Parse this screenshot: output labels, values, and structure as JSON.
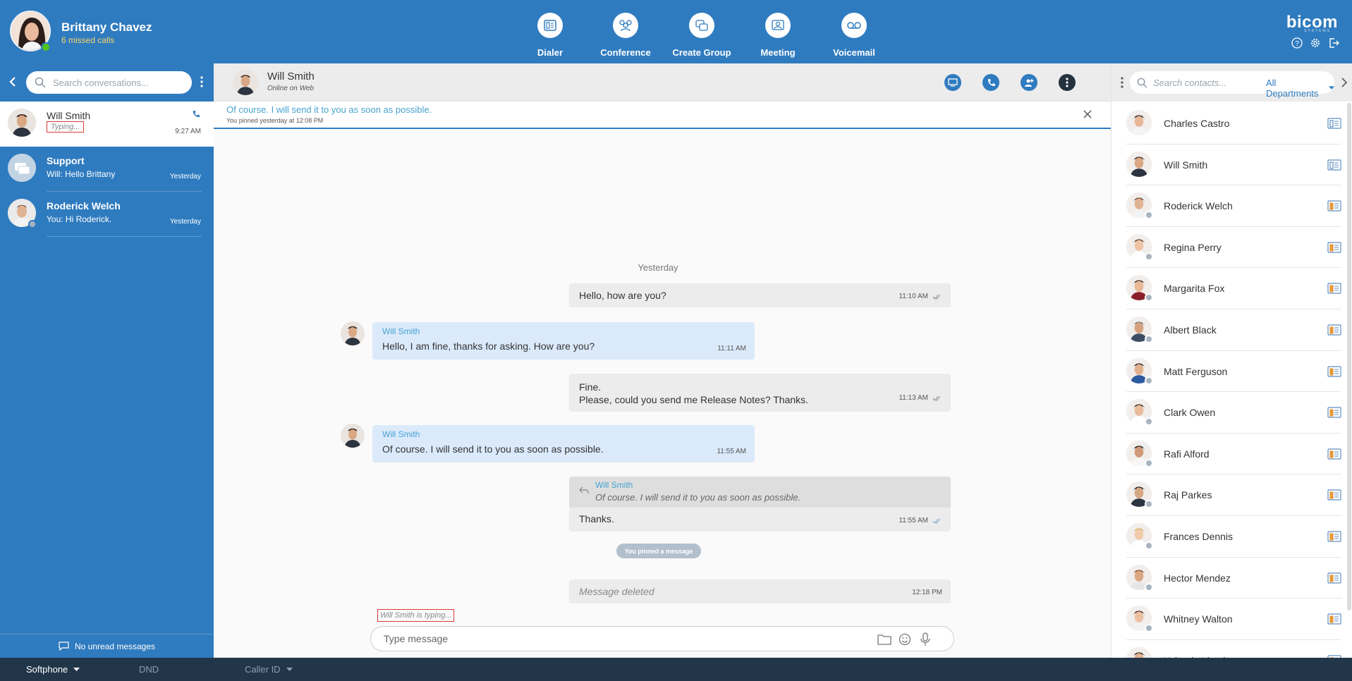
{
  "header": {
    "user_name": "Brittany Chavez",
    "missed_calls": "6 missed calls",
    "nav": [
      {
        "label": "Dialer",
        "icon": "dialer-icon"
      },
      {
        "label": "Conference",
        "icon": "conference-icon"
      },
      {
        "label": "Create Group",
        "icon": "create-group-icon"
      },
      {
        "label": "Meeting",
        "icon": "meeting-icon"
      },
      {
        "label": "Voicemail",
        "icon": "voicemail-icon"
      }
    ],
    "brand": "bicom",
    "brand_sub": "SYSTEMS",
    "icons": [
      "help-icon",
      "settings-icon",
      "logout-icon"
    ]
  },
  "sidebar": {
    "search_placeholder": "Search conversations...",
    "conversations": [
      {
        "name": "Will Smith",
        "preview": "Typing...",
        "time": "9:27 AM",
        "active": true,
        "icon": "phone-icon"
      },
      {
        "name": "Support",
        "preview": "Will: Hello Brittany",
        "time": "Yesterday"
      },
      {
        "name": "Roderick Welch",
        "preview": "You: Hi Roderick.",
        "time": "Yesterday"
      }
    ],
    "footer": "No unread messages"
  },
  "chat": {
    "contact_name": "Will Smith",
    "contact_status": "Online on Web",
    "actions": [
      "screen-share-icon",
      "call-icon",
      "add-participant-icon",
      "more-icon"
    ],
    "pinned": {
      "text": "Of course. I will send it to you as soon as possible.",
      "meta": "You pinned yesterday at 12:08 PM"
    },
    "day_separator": "Yesterday",
    "messages": [
      {
        "dir": "out",
        "text": "Hello, how are you?",
        "time": "11:10 AM"
      },
      {
        "dir": "in",
        "from": "Will Smith",
        "text": "Hello, I am fine, thanks for asking. How are you?",
        "time": "11:11 AM"
      },
      {
        "dir": "out",
        "line1": "Fine.",
        "line2": "Please, could you send me Release Notes? Thanks.",
        "time": "11:13 AM"
      },
      {
        "dir": "in",
        "from": "Will Smith",
        "text": "Of course. I will send it to you as soon as possible.",
        "time": "11:55 AM"
      },
      {
        "dir": "out",
        "quote_from": "Will Smith",
        "quote_text": "Of course. I will send it to you as soon as possible.",
        "text": "Thanks.",
        "time": "11:55 AM"
      },
      {
        "dir": "out",
        "text": "Message deleted",
        "time": "12:18 PM"
      }
    ],
    "pinned_notice": "You pinned a message",
    "typing": "Will Smith is typing...",
    "composer_placeholder": "Type message"
  },
  "contacts": {
    "search_placeholder": "Search contacts...",
    "department": "All Departments",
    "list": [
      "Charles Castro",
      "Will Smith",
      "Roderick Welch",
      "Regina Perry",
      "Margarita Fox",
      "Albert Black",
      "Matt Ferguson",
      "Clark Owen",
      "Rafi Alford",
      "Raj Parkes",
      "Frances Dennis",
      "Hector Mendez",
      "Whitney Walton",
      "Yolanda Lloyd"
    ]
  },
  "bottom": {
    "softphone": "Softphone",
    "dnd": "DND",
    "caller_id": "Caller ID"
  },
  "colors": {
    "primary": "#2f7bbf",
    "bottom_bar": "#22364a",
    "online": "#52c41a",
    "offline": "#a8b4c0",
    "incoming_bubble": "#dbeafb",
    "outgoing_bubble": "#ececec"
  }
}
